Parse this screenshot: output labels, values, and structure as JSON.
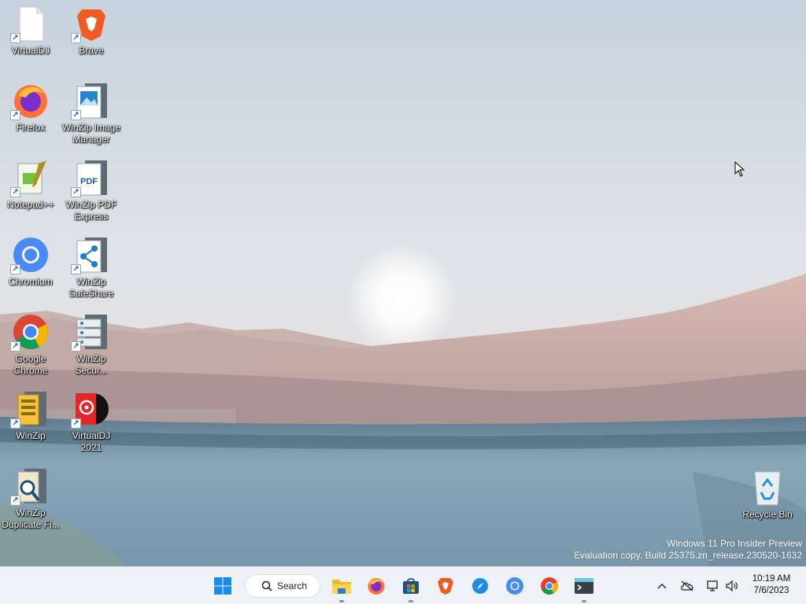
{
  "desktop_icons": [
    {
      "label": "VirtualDJ",
      "icon": "file-icon"
    },
    {
      "label": "Brave",
      "icon": "brave-icon"
    },
    {
      "label": "Firefox",
      "icon": "firefox-icon"
    },
    {
      "label": "WinZip Image Manager",
      "icon": "winzip-image-manager-icon"
    },
    {
      "label": "Notepad++",
      "icon": "notepad-plus-plus-icon"
    },
    {
      "label": "WinZip PDF Express",
      "icon": "winzip-pdf-express-icon"
    },
    {
      "label": "Chromium",
      "icon": "chromium-icon"
    },
    {
      "label": "WinZip SafeShare",
      "icon": "winzip-safeshare-icon"
    },
    {
      "label": "Google Chrome",
      "icon": "chrome-icon"
    },
    {
      "label": "WinZip Secur...",
      "icon": "winzip-secure-backup-icon"
    },
    {
      "label": "WinZip",
      "icon": "winzip-icon"
    },
    {
      "label": "VirtualDJ 2021",
      "icon": "virtualdj-icon"
    },
    {
      "label": "WinZip Duplicate Fi...",
      "icon": "winzip-duplicate-finder-icon"
    },
    {
      "label": "Recycle Bin",
      "icon": "recycle-bin-icon"
    }
  ],
  "watermark": {
    "line1": "Windows 11 Pro Insider Preview",
    "line2": "Evaluation copy. Build 25375.zn_release.230520-1632"
  },
  "taskbar": {
    "search_label": "Search",
    "pinned": [
      "start-icon",
      "file-explorer-icon",
      "firefox-icon",
      "microsoft-store-icon",
      "brave-icon",
      "compass-icon",
      "chromium-icon",
      "chrome-icon",
      "terminal-icon"
    ],
    "clock": {
      "time": "10:19 AM",
      "date": "7/6/2023"
    }
  },
  "colors": {
    "taskbar_bg": "#eef1f6",
    "sky_top": "#c7d3de",
    "water": "#7e9eb3"
  }
}
